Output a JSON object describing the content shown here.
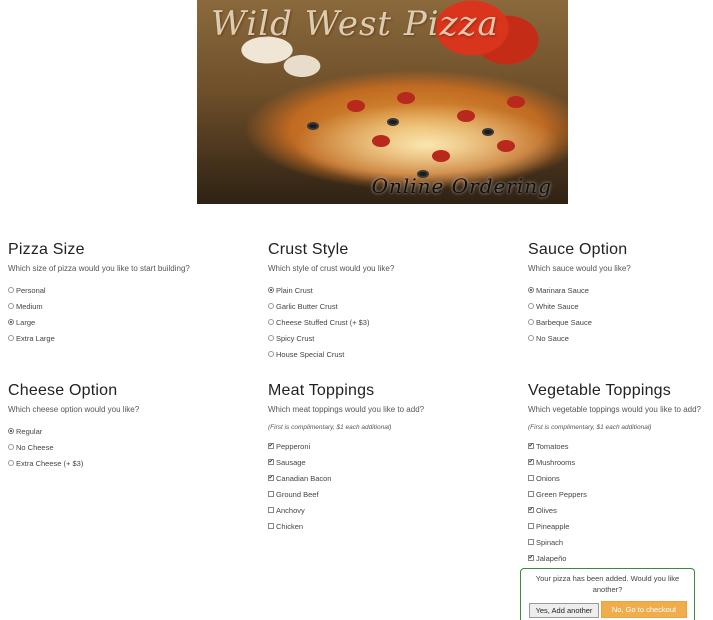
{
  "hero": {
    "title": "Wild West Pizza",
    "subtitle": "Online Ordering"
  },
  "sections": {
    "size": {
      "heading": "Pizza Size",
      "prompt": "Which size of pizza would you like to start building?",
      "options": [
        {
          "label": "Personal",
          "selected": false
        },
        {
          "label": "Medium",
          "selected": false
        },
        {
          "label": "Large",
          "selected": true
        },
        {
          "label": "Extra Large",
          "selected": false
        }
      ]
    },
    "crust": {
      "heading": "Crust Style",
      "prompt": "Which style of crust would you like?",
      "options": [
        {
          "label": "Plain Crust",
          "selected": true
        },
        {
          "label": "Garlic Butter Crust",
          "selected": false
        },
        {
          "label": "Cheese Stuffed Crust (+ $3)",
          "selected": false
        },
        {
          "label": "Spicy Crust",
          "selected": false
        },
        {
          "label": "House Special Crust",
          "selected": false
        }
      ]
    },
    "sauce": {
      "heading": "Sauce Option",
      "prompt": "Which sauce would you like?",
      "options": [
        {
          "label": "Marinara Sauce",
          "selected": true
        },
        {
          "label": "White Sauce",
          "selected": false
        },
        {
          "label": "Barbeque Sauce",
          "selected": false
        },
        {
          "label": "No Sauce",
          "selected": false
        }
      ]
    },
    "cheese": {
      "heading": "Cheese Option",
      "prompt": "Which cheese option would you like?",
      "options": [
        {
          "label": "Regular",
          "selected": true
        },
        {
          "label": "No Cheese",
          "selected": false
        },
        {
          "label": "Extra Cheese (+ $3)",
          "selected": false
        }
      ]
    },
    "meat": {
      "heading": "Meat Toppings",
      "prompt": "Which meat toppings would you like to add?",
      "note": "(First is complimentary, $1 each additional)",
      "options": [
        {
          "label": "Pepperoni",
          "checked": true
        },
        {
          "label": "Sausage",
          "checked": true
        },
        {
          "label": "Canadian Bacon",
          "checked": true
        },
        {
          "label": "Ground Beef",
          "checked": false
        },
        {
          "label": "Anchovy",
          "checked": false
        },
        {
          "label": "Chicken",
          "checked": false
        }
      ]
    },
    "veg": {
      "heading": "Vegetable Toppings",
      "prompt": "Which vegetable toppings would you like to add?",
      "note": "(First is complimentary, $1 each additional)",
      "options": [
        {
          "label": "Tomatoes",
          "checked": true
        },
        {
          "label": "Mushrooms",
          "checked": true
        },
        {
          "label": "Onions",
          "checked": false
        },
        {
          "label": "Green Peppers",
          "checked": false
        },
        {
          "label": "Olives",
          "checked": true
        },
        {
          "label": "Pineapple",
          "checked": false
        },
        {
          "label": "Spinach",
          "checked": false
        },
        {
          "label": "Jalapeño",
          "checked": true
        }
      ]
    }
  },
  "popup": {
    "message": "Your pizza has been added. Would you like another?",
    "yes_label": "Yes, Add another",
    "no_label": "No, Go to checkout"
  },
  "colors": {
    "checkout_button": "#f0ad4e",
    "popup_border": "#3a8a3a"
  }
}
